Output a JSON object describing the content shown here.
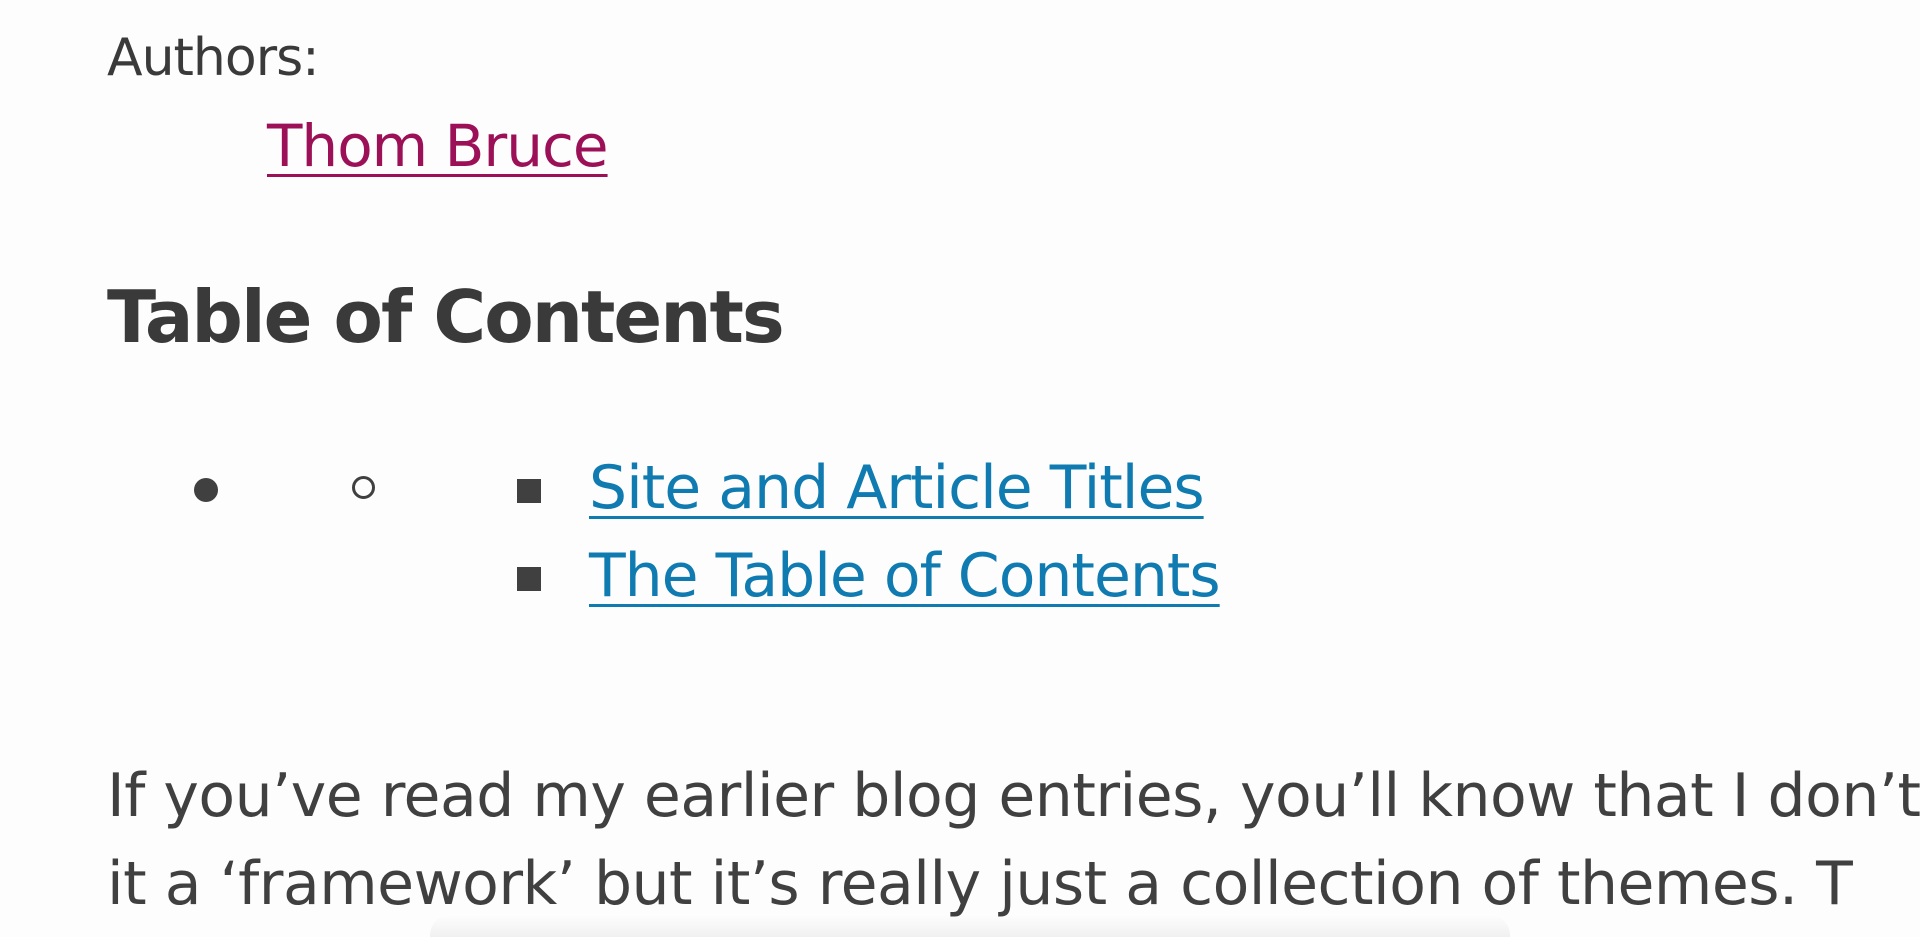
{
  "authors": {
    "label": "Authors:",
    "names": [
      "Thom Bruce"
    ]
  },
  "toc": {
    "heading": "Table of Contents",
    "items": [
      "Site and Article Titles",
      "The Table of Contents"
    ]
  },
  "article": {
    "lines": [
      "If you’ve read my earlier blog entries, you’ll know that I don’t",
      "it a ‘framework’ but it’s really just a collection of themes. T"
    ]
  },
  "colors": {
    "author_link": "#9c1057",
    "toc_link": "#0f7bb0",
    "text": "#404040"
  }
}
